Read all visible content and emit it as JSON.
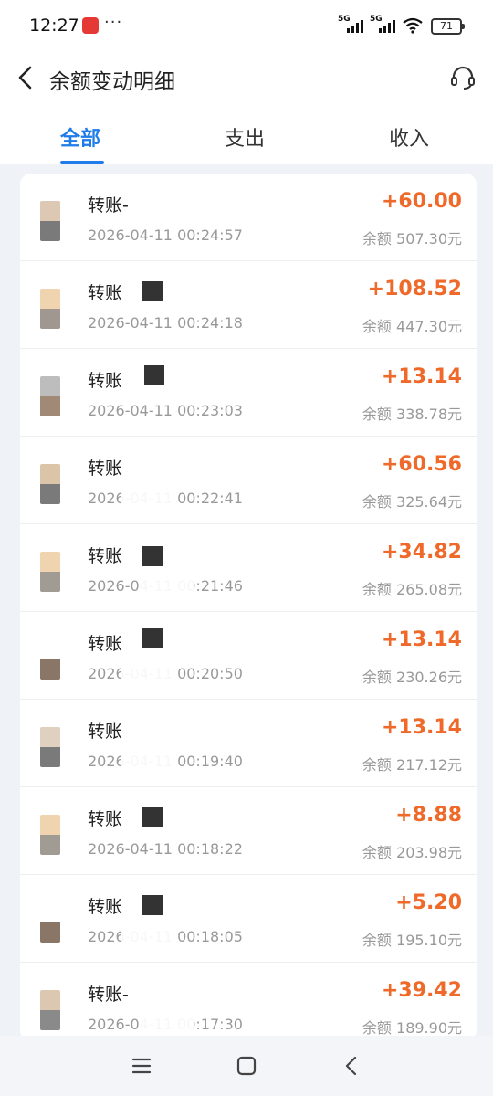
{
  "status": {
    "time": "12:27",
    "dots": "···",
    "net1": "5G",
    "net2": "5G",
    "battery": "71"
  },
  "header": {
    "title": "余额变动明细"
  },
  "tabs": [
    {
      "label": "全部",
      "active": true
    },
    {
      "label": "支出",
      "active": false
    },
    {
      "label": "收入",
      "active": false
    }
  ],
  "transactions": [
    {
      "title": "转账-",
      "date": "2026-04-11 00:24:57",
      "amount": "+60.00",
      "balance": "余额 507.30元",
      "avatar": [
        "#ddc8b4",
        "#7a7a7a"
      ]
    },
    {
      "title": "转账",
      "date": "2026-04-11 00:24:18",
      "amount": "+108.52",
      "balance": "余额 447.30元",
      "avatar": [
        "#f0d4b0",
        "#a09890"
      ]
    },
    {
      "title": "转账",
      "date": "2026-04-11 00:23:03",
      "amount": "+13.14",
      "balance": "余额 338.78元",
      "avatar": [
        "#bdbdbd",
        "#a08a76"
      ]
    },
    {
      "title": "转账",
      "date": "2026-04-11 00:22:41",
      "amount": "+60.56",
      "balance": "余额 325.64元",
      "avatar": [
        "#dcc4a8",
        "#7a7a7a"
      ]
    },
    {
      "title": "转账",
      "date": "2026-04-11 00:21:46",
      "amount": "+34.82",
      "balance": "余额 265.08元",
      "avatar": [
        "#f0d4b0",
        "#a09c94"
      ]
    },
    {
      "title": "转账",
      "date": "2026-04-11 00:20:50",
      "amount": "+13.14",
      "balance": "余额 230.26元",
      "avatar": [
        "#ffffff",
        "#8a7666"
      ]
    },
    {
      "title": "转账",
      "date": "2026-04-11 00:19:40",
      "amount": "+13.14",
      "balance": "余额 217.12元",
      "avatar": [
        "#e0d0c0",
        "#7a7a7a"
      ]
    },
    {
      "title": "转账",
      "date": "2026-04-11 00:18:22",
      "amount": "+8.88",
      "balance": "余额 203.98元",
      "avatar": [
        "#f0d4b0",
        "#a09c94"
      ]
    },
    {
      "title": "转账",
      "date": "2026-04-11 00:18:05",
      "amount": "+5.20",
      "balance": "余额 195.10元",
      "avatar": [
        "#ffffff",
        "#8a7666"
      ]
    },
    {
      "title": "转账-",
      "date": "2026-04-11 00:17:30",
      "amount": "+39.42",
      "balance": "余额 189.90元",
      "avatar": [
        "#dcc8b0",
        "#8a8a8a"
      ]
    }
  ]
}
